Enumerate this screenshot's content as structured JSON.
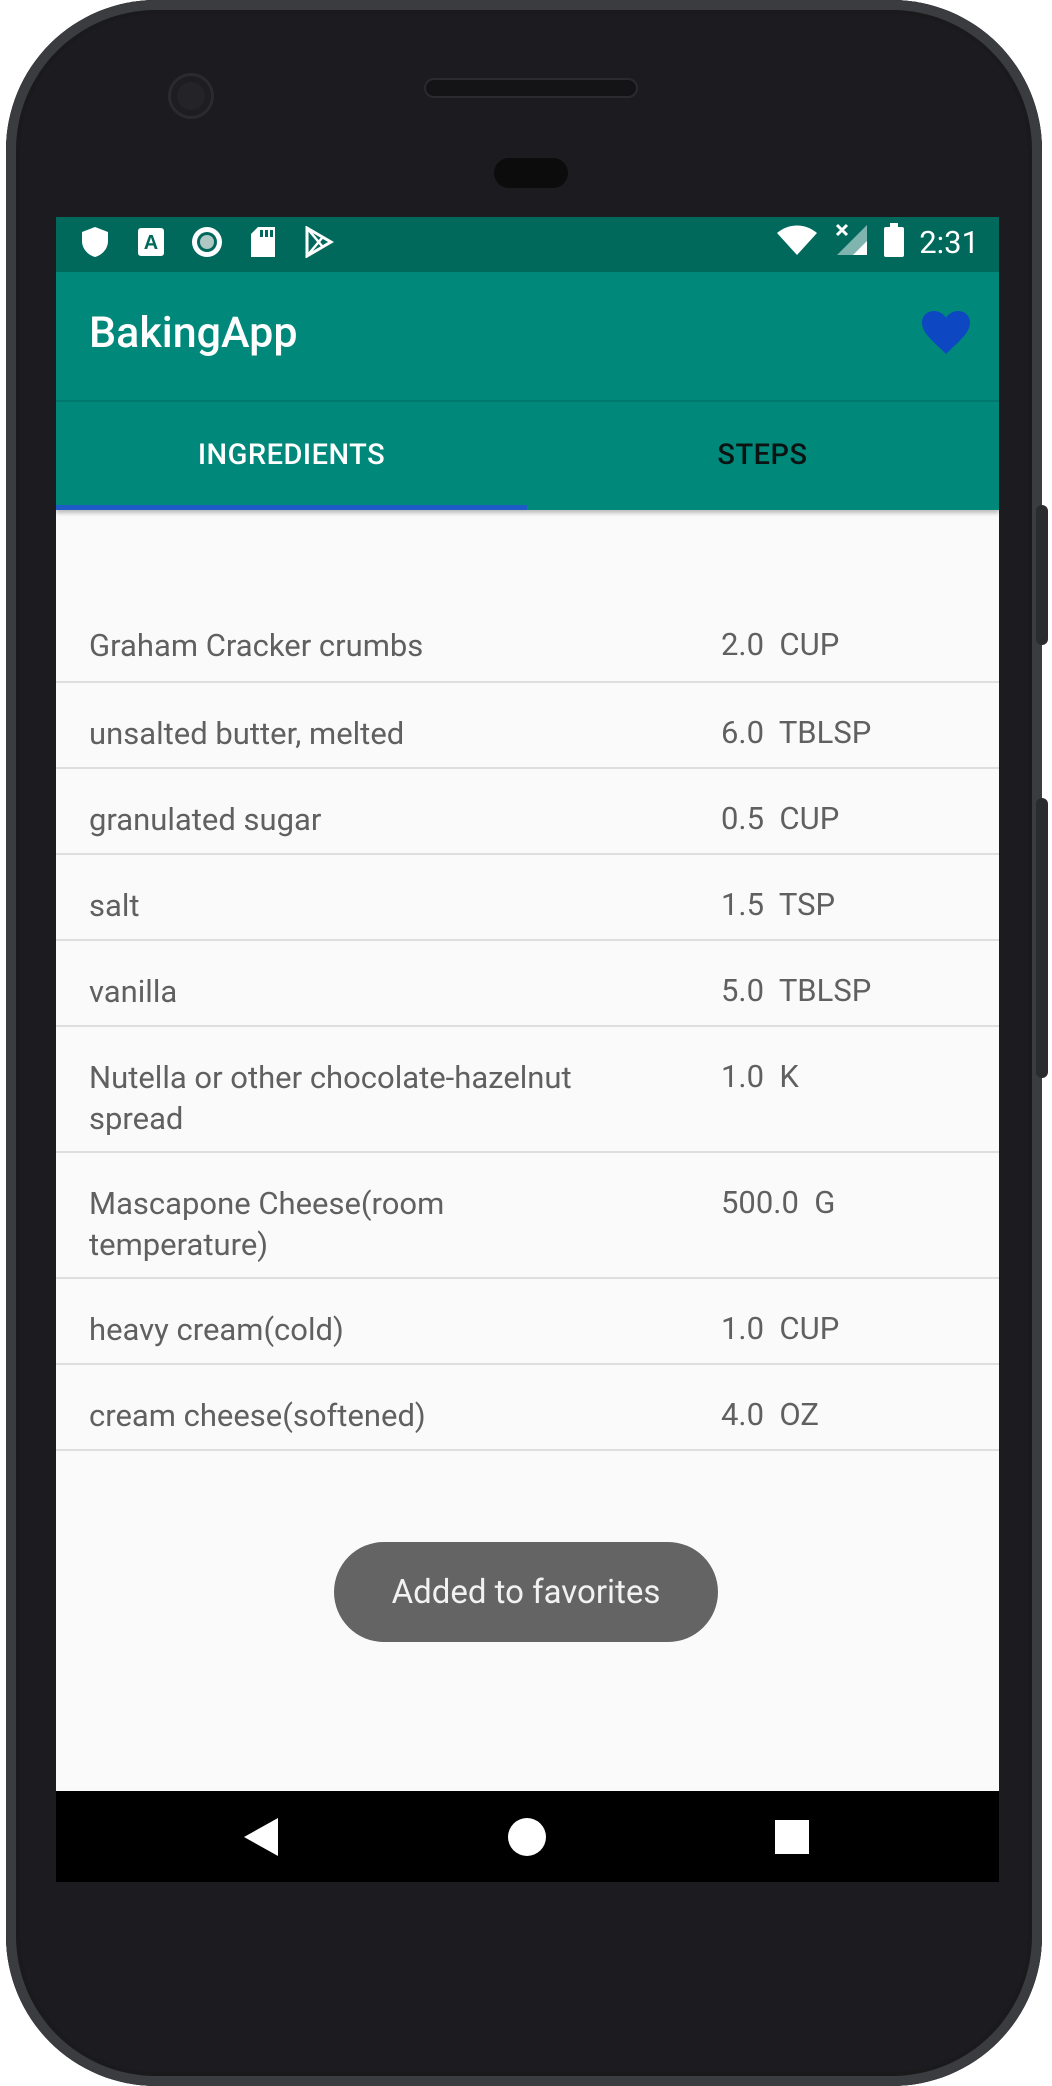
{
  "status_bar": {
    "time": "2:31",
    "left_icons": [
      "shield-icon",
      "a-icon",
      "circle-record-icon",
      "sd-card-icon",
      "play-store-icon"
    ],
    "right_icons": [
      "wifi-icon",
      "signal-off-icon",
      "battery-icon"
    ]
  },
  "app_bar": {
    "title": "BakingApp",
    "favorite_icon": "heart-icon",
    "favorite_color": "#0d47c1"
  },
  "tabs": [
    {
      "label": "INGREDIENTS",
      "active": true
    },
    {
      "label": "STEPS",
      "active": false
    }
  ],
  "ingredients": [
    {
      "name": "Graham Cracker crumbs",
      "quantity": "2.0",
      "unit": "CUP"
    },
    {
      "name": "unsalted butter, melted",
      "quantity": "6.0",
      "unit": "TBLSP"
    },
    {
      "name": "granulated sugar",
      "quantity": "0.5",
      "unit": "CUP"
    },
    {
      "name": "salt",
      "quantity": "1.5",
      "unit": "TSP"
    },
    {
      "name": "vanilla",
      "quantity": "5.0",
      "unit": "TBLSP"
    },
    {
      "name": "Nutella or other chocolate-hazelnut spread",
      "quantity": "1.0",
      "unit": "K"
    },
    {
      "name": "Mascapone Cheese(room temperature)",
      "quantity": "500.0",
      "unit": "G"
    },
    {
      "name": "heavy cream(cold)",
      "quantity": "1.0",
      "unit": "CUP"
    },
    {
      "name": "cream cheese(softened)",
      "quantity": "4.0",
      "unit": "OZ"
    }
  ],
  "toast": {
    "text": "Added to favorites"
  },
  "nav_bar": {
    "buttons": [
      "back-icon",
      "home-icon",
      "recents-icon"
    ]
  },
  "colors": {
    "status_bar": "#00695c",
    "app_bar": "#00897b",
    "tab_indicator": "#1e5bc6"
  }
}
